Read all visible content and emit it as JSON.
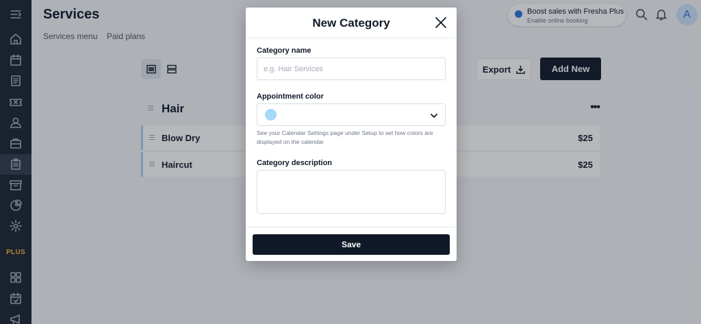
{
  "sidebar": {
    "items": [
      {
        "icon": "collapse-menu-icon"
      },
      {
        "icon": "home-icon"
      },
      {
        "icon": "calendar-icon"
      },
      {
        "icon": "sales-icon"
      },
      {
        "icon": "voucher-icon"
      },
      {
        "icon": "client-icon"
      },
      {
        "icon": "staff-icon"
      },
      {
        "icon": "services-icon"
      },
      {
        "icon": "inventory-icon"
      },
      {
        "icon": "analytics-icon"
      },
      {
        "icon": "settings-icon"
      },
      {
        "icon": "apps-icon"
      },
      {
        "icon": "online-booking-icon"
      },
      {
        "icon": "marketing-icon"
      }
    ],
    "plus_label": "PLUS"
  },
  "header": {
    "title": "Services",
    "tabs": [
      "Services menu",
      "Paid plans"
    ],
    "boost_title": "Boost sales with Fresha Plus",
    "boost_subtitle": "Enable online booking",
    "avatar_initial": "A"
  },
  "toolbar": {
    "export_label": "Export",
    "add_new_label": "Add New"
  },
  "category": {
    "name": "Hair",
    "more_label": "•••",
    "services": [
      {
        "name": "Blow Dry",
        "price": "$25"
      },
      {
        "name": "Haircut",
        "price": "$25"
      }
    ]
  },
  "modal": {
    "title": "New Category",
    "name_label": "Category name",
    "name_placeholder": "e.g. Hair Services",
    "name_value": "",
    "color_label": "Appointment color",
    "color_value": "#a6d8f7",
    "helper_text": "See your Calendar Settings page under Setup to set how colors are displayed on the calendar",
    "description_label": "Category description",
    "description_value": "",
    "save_label": "Save"
  },
  "colors": {
    "sidebar_bg": "#1b2330",
    "primary_button": "#101928",
    "accent_blue": "#2a72e5",
    "category_stripe": "#a6d1f5",
    "plus_gold": "#f2b544"
  }
}
